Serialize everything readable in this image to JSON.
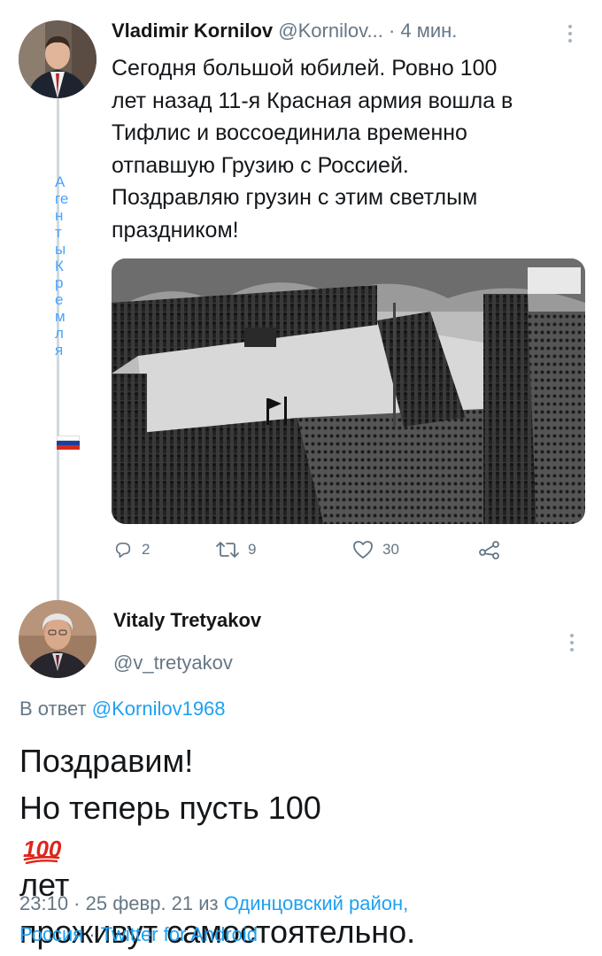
{
  "tweet1": {
    "display_name": "Vladimir Kornilov",
    "handle": "@Kornilov...",
    "time": "· 4 мин.",
    "text_lines": [
      "Сегодня большой юбилей. Ровно 100",
      "лет назад 11-я Красная армия вошла в",
      "Тифлис и воссоединила временно",
      "отпавшую Грузию с Россией.",
      "Поздравляю грузин с этим светлым",
      "праздником!"
    ],
    "replies_count": "2",
    "retweets_count": "9",
    "likes_count": "30"
  },
  "watermark": {
    "chars": [
      "А",
      "ге",
      "н",
      "т",
      "ы",
      "К",
      "р",
      "е",
      "м",
      "л",
      "я"
    ],
    "flag_colors": [
      "#ffffff",
      "#1c3f9e",
      "#d52b1e"
    ]
  },
  "tweet2": {
    "display_name": "Vitaly Tretyakov",
    "handle": "@v_tretyakov",
    "reply_prefix": "В ответ",
    "reply_to": "@Kornilov1968",
    "line1": "Поздравим!",
    "line2_before": "Но теперь пусть 100",
    "emoji": "💯",
    "line2_after": "лет",
    "line3": "проживут самостоятельно.",
    "timestamp": "23:10 · 25 февр. 21 из",
    "location": "Одинцовский район,",
    "location2": "Россия",
    "separator": "·",
    "client": "Twitter for Android"
  },
  "colors": {
    "link": "#1da1f2",
    "muted": "#657786",
    "hundred_red": "#e0241b"
  }
}
